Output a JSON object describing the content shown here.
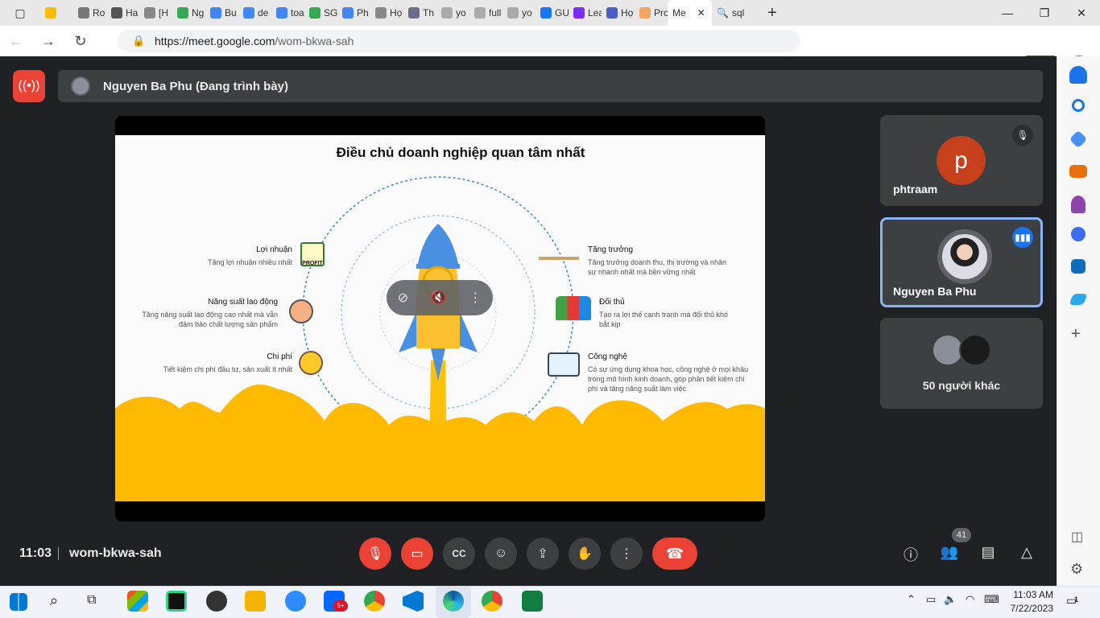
{
  "browser": {
    "tabs": [
      {
        "label": "",
        "color": "#fbbc04"
      },
      {
        "label": "Ro",
        "color": "#777777"
      },
      {
        "label": "Ha",
        "color": "#555555"
      },
      {
        "label": "[H",
        "color": "#888888"
      },
      {
        "label": "Ng",
        "color": "#34a853"
      },
      {
        "label": "Bu",
        "color": "#4285f4"
      },
      {
        "label": "de",
        "color": "#4285f4"
      },
      {
        "label": "toa",
        "color": "#4285f4"
      },
      {
        "label": "SG",
        "color": "#34a853"
      },
      {
        "label": "Ph",
        "color": "#4285f4"
      },
      {
        "label": "Họ",
        "color": "#888888"
      },
      {
        "label": "Th",
        "color": "#6b6b8f"
      },
      {
        "label": "yo",
        "color": "#aaaaaa"
      },
      {
        "label": "full",
        "color": "#aaaaaa"
      },
      {
        "label": "yo",
        "color": "#aaaaaa"
      },
      {
        "label": "GU",
        "color": "#1877f2"
      },
      {
        "label": "Lea",
        "color": "#7b2cf5"
      },
      {
        "label": "Họ",
        "color": "#4a5fc1"
      },
      {
        "label": "Prc",
        "color": "#f4a460"
      }
    ],
    "active_tab": {
      "label": "Me",
      "close": "✕"
    },
    "url_host": "https://meet.google.com",
    "url_path": "/wom-bkwa-sah",
    "new_tab": "+"
  },
  "meet": {
    "presenter_label": "Nguyen Ba Phu (Đang trình bày)",
    "slide": {
      "title": "Điều chủ doanh nghiệp quan tâm nhất",
      "left_items": [
        {
          "heading": "Lợi nhuận",
          "text": "Tăng lợi nhuận nhiều nhất"
        },
        {
          "heading": "Năng suất lao động",
          "text": "Tăng năng suất lao động cao nhất mà vẫn đảm bảo chất lượng sản phẩm"
        },
        {
          "heading": "Chi phí",
          "text": "Tiết kiệm chi phí đầu tư, sản xuất ít nhất"
        }
      ],
      "right_items": [
        {
          "heading": "Tăng trưởng",
          "text": "Tăng trưởng doanh thu, thị trường và nhân sự nhanh nhất mà bền vững nhất"
        },
        {
          "heading": "Đối thủ",
          "text": "Tạo ra lợi thế cạnh tranh mà đối thủ khó bắt kịp"
        },
        {
          "heading": "Công nghệ",
          "text": "Có sự ứng dụng khoa học, công nghệ ở mọi khâu trong mô hình kinh doanh, góp phần tiết kiệm chi phí và tăng năng suất làm việc"
        }
      ],
      "profit_badge": "PROFIT"
    },
    "participants": [
      {
        "name": "phtraam",
        "initial": "p",
        "avatar_color": "#c5401b"
      },
      {
        "name": "Nguyen Ba Phu"
      },
      {
        "name": "50 người khác"
      }
    ],
    "meeting_time": "11:03",
    "meeting_code": "wom-bkwa-sah",
    "participant_count": "41"
  },
  "taskbar": {
    "time": "11:03 AM",
    "date": "7/22/2023",
    "zalo_badge": "5+",
    "notif_count": "1"
  }
}
